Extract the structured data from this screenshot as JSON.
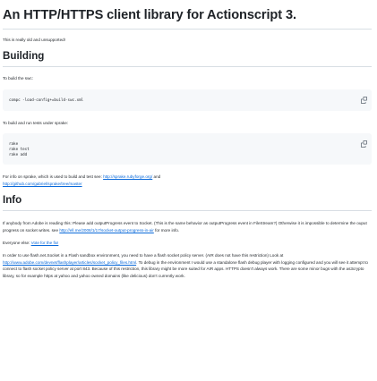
{
  "title": "An HTTP/HTTPS client library for Actionscript 3.",
  "intro": "This is really old and unsupported!",
  "building": {
    "heading": "Building",
    "build_text": "To build the swc:",
    "build_code": "compc -load-config+=build-swc.xml",
    "run_text": "To build and run tests under sprake:",
    "run_code": [
      "rake",
      "rake test",
      "rake add"
    ],
    "more_prefix": "For info on sprake, which is used to build and test see: ",
    "more_link1": "http://sprake.rubyforge.org/",
    "more_mid": " and ",
    "more_link2": "http://github.com/gabriel/sprake/tree/master"
  },
  "info": {
    "heading": "Info",
    "anybody_text": "If anybody from Adobe is reading this: Please add outputProgress event to Socket. (This is the same behavior as outputProgress event in FileStream?) Otherwise it is impossible to determine the ouput progress on socket writes. see ",
    "anybody_link": "http://ell.me/2008/1/17/socket-output-progress-in-air",
    "anybody_suffix": " for more info.",
    "else_prefix": "Everyone else: ",
    "else_link": "Vote for the fix!",
    "order_prefix": "In order to use flash.net.Socket in a Flash sandbox environment, you need to have a flash socket policy server. (AIR does not have this restriction) Look at ",
    "order_link": "http://www.adobe.com/devnet/flashplayer/articles/socket_policy_files.html",
    "order_suffix": ". To debug in the environment I would use a standalone flash debug player with logging configured and you will see it attempt to connect to flash socket policy server at port 843. Because of this restriction, this library might be more suited for AIR apps. HTTPS doesn't always work. There are some minor bugs with the as3crypto library, so for example https at yahoo and yahoo owned domains (like delicious) don't currently work."
  },
  "icons": {
    "copy": "copy-icon"
  },
  "colors": {
    "link": "#0969da",
    "code_bg": "#f6f8fa",
    "rule": "#d8dee4"
  }
}
